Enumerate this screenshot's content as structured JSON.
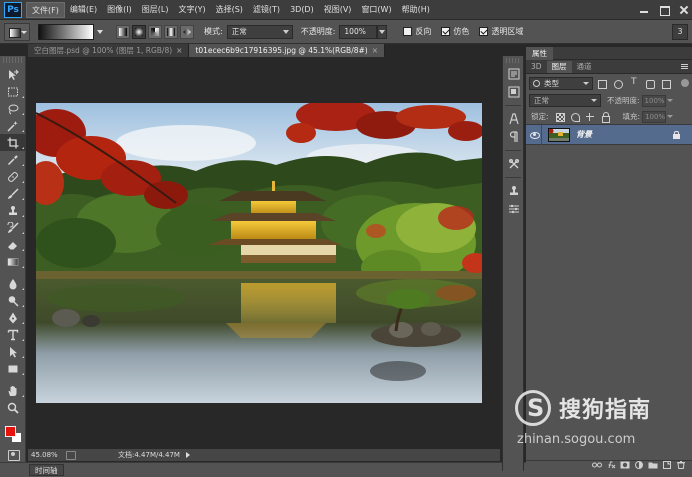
{
  "app": {
    "logo_text": "Ps"
  },
  "menubar": {
    "items": [
      "文件(F)",
      "编辑(E)",
      "图像(I)",
      "图层(L)",
      "文字(Y)",
      "选择(S)",
      "滤镜(T)",
      "3D(D)",
      "视图(V)",
      "窗口(W)",
      "帮助(H)"
    ]
  },
  "options": {
    "mode_label": "模式:",
    "mode_value": "正常",
    "opacity_label": "不透明度:",
    "opacity_value": "100%",
    "reverse_label": "反向",
    "reverse_checked": false,
    "dither_label": "仿色",
    "dither_checked": true,
    "transparency_label": "透明区域",
    "transparency_checked": true,
    "right_button": "3"
  },
  "tabs": [
    {
      "label": "空白图层.psd @ 100% (图层 1, RGB/8)",
      "close": "×",
      "active": false
    },
    {
      "label": "t01ecec6b9c17916395.jpg @ 45.1%(RGB/8#)",
      "close": "×",
      "active": true
    }
  ],
  "toolbox": {
    "tools": [
      "move-tool",
      "marquee-tool",
      "lasso-tool",
      "quick-select-tool",
      "crop-tool",
      "eyedropper-tool",
      "healing-brush-tool",
      "brush-tool",
      "clone-stamp-tool",
      "history-brush-tool",
      "eraser-tool",
      "gradient-tool",
      "blur-tool",
      "dodge-tool",
      "pen-tool",
      "type-tool",
      "path-select-tool",
      "shape-tool",
      "hand-tool",
      "zoom-tool"
    ],
    "active_tool": "crop-tool",
    "foreground_color": "#e8120c",
    "background_color": "#ffffff"
  },
  "status": {
    "zoom": "45.08%",
    "doc_size": "文档:4.47M/4.47M"
  },
  "timeline": {
    "label": "时间轴"
  },
  "panels": {
    "properties_tab": "属性",
    "tabs": [
      "3D",
      "图层",
      "通道"
    ],
    "active_tab": "图层",
    "filter_kind": "类型",
    "blend_mode": "正常",
    "opacity_label": "不透明度:",
    "opacity_value": "100%",
    "lock_label": "锁定:",
    "fill_label": "填充:",
    "fill_value": "100%",
    "layers": [
      {
        "name": "背景",
        "visible": true,
        "locked": true,
        "selected": true
      }
    ],
    "footer_icons": [
      "link-icon",
      "fx-icon",
      "mask-icon",
      "adjustment-icon",
      "group-icon",
      "new-layer-icon",
      "trash-icon"
    ]
  },
  "watermark": {
    "logo_letter": "S",
    "brand": "搜狗指南",
    "url": "zhinan.sogou.com"
  }
}
